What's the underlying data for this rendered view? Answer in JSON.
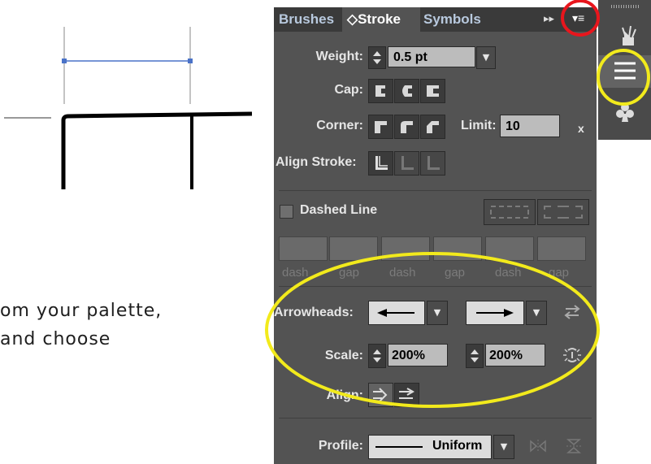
{
  "tutorial": {
    "line1": "om your palette,",
    "line2": "and choose"
  },
  "panel": {
    "tabs": [
      {
        "label": "Brushes"
      },
      {
        "label": "◇Stroke",
        "active": true
      },
      {
        "label": "Symbols"
      }
    ],
    "expand_glyph": "▸▸",
    "menu_glyph": "▾≡",
    "weight": {
      "label": "Weight:",
      "value": "0.5 pt"
    },
    "cap": {
      "label": "Cap:"
    },
    "corner": {
      "label": "Corner:",
      "limit_label": "Limit:",
      "limit_value": "10",
      "unit": "x"
    },
    "align_stroke": {
      "label": "Align Stroke:"
    },
    "dashed_line": {
      "label": "Dashed Line",
      "checked": false
    },
    "dash_labels": [
      "dash",
      "gap",
      "dash",
      "gap",
      "dash",
      "gap"
    ],
    "arrowheads": {
      "label": "Arrowheads:"
    },
    "scale": {
      "label": "Scale:",
      "start": "200%",
      "end": "200%"
    },
    "align": {
      "label": "Align:"
    },
    "profile": {
      "label": "Profile:",
      "value": "Uniform"
    }
  },
  "annotations": {
    "highlight_color": "#f2ea1c",
    "alert_color": "#e8161d"
  }
}
